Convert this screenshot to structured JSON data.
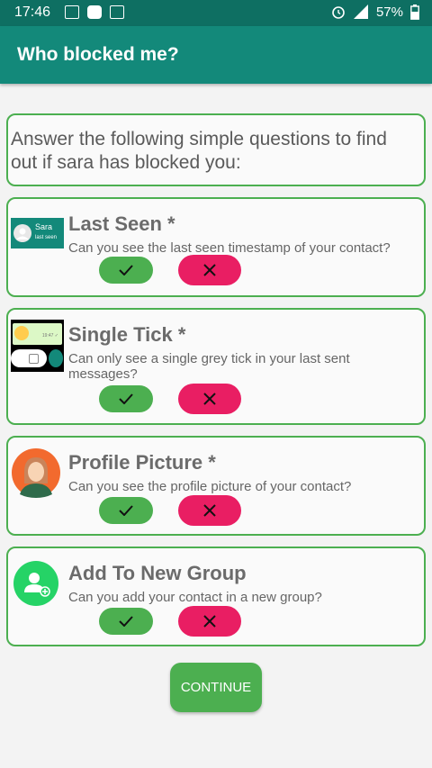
{
  "status": {
    "time": "17:46",
    "battery": "57%"
  },
  "appbar": {
    "title": "Who blocked me?"
  },
  "intro": {
    "text": "Answer the following simple questions to find out if sara has blocked you:"
  },
  "questions": [
    {
      "title": "Last Seen *",
      "desc": "Can you see the last seen timestamp of your contact?",
      "thumb_name": "Sara",
      "thumb_sub": "last seen"
    },
    {
      "title": "Single Tick *",
      "desc": "Can only see a single grey tick in your last sent messages?",
      "thumb_time": "19:47 ✓"
    },
    {
      "title": "Profile Picture *",
      "desc": "Can you see the profile picture of your contact?"
    },
    {
      "title": "Add To New Group",
      "desc": "Can you add your contact in a new group?"
    }
  ],
  "continue_label": "CONTINUE",
  "colors": {
    "primary": "#13897a",
    "status": "#0e6f62",
    "yes": "#4caf50",
    "no": "#e91e63",
    "border": "#4caf50"
  }
}
